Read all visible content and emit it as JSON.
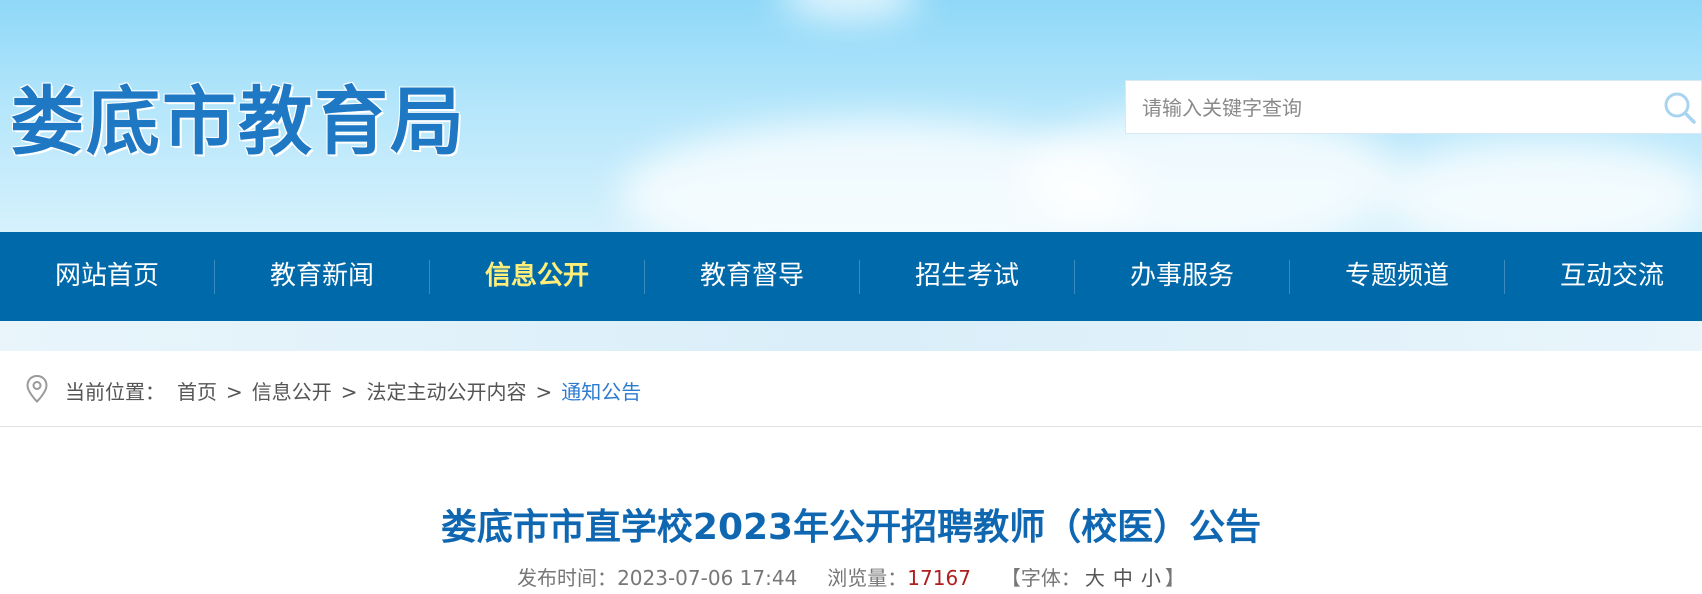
{
  "header": {
    "site_title": "娄底市教育局",
    "search": {
      "placeholder": "请输入关键字查询"
    }
  },
  "nav": {
    "items": [
      {
        "label": "网站首页",
        "active": false
      },
      {
        "label": "教育新闻",
        "active": false
      },
      {
        "label": "信息公开",
        "active": true
      },
      {
        "label": "教育督导",
        "active": false
      },
      {
        "label": "招生考试",
        "active": false
      },
      {
        "label": "办事服务",
        "active": false
      },
      {
        "label": "专题频道",
        "active": false
      },
      {
        "label": "互动交流",
        "active": false
      }
    ]
  },
  "breadcrumb": {
    "label": "当前位置：",
    "separator": ">",
    "items": [
      "首页",
      "信息公开",
      "法定主动公开内容",
      "通知公告"
    ]
  },
  "article": {
    "title": "娄底市市直学校2023年公开招聘教师（校医）公告",
    "publish_label": "发布时间：",
    "publish_time": "2023-07-06 17:44",
    "views_label": "浏览量：",
    "views": "17167",
    "font_open": "【字体：",
    "font_large": "大",
    "font_medium": "中",
    "font_small": "小",
    "font_close": "】"
  },
  "colors": {
    "nav_bg": "#0069aa",
    "nav_active": "#ffef7a",
    "title": "#0f67b1",
    "breadcrumb_current": "#2d7bd1",
    "views": "#b01e1e"
  },
  "icons": {
    "search": "search-icon",
    "location": "location-pin-icon"
  }
}
